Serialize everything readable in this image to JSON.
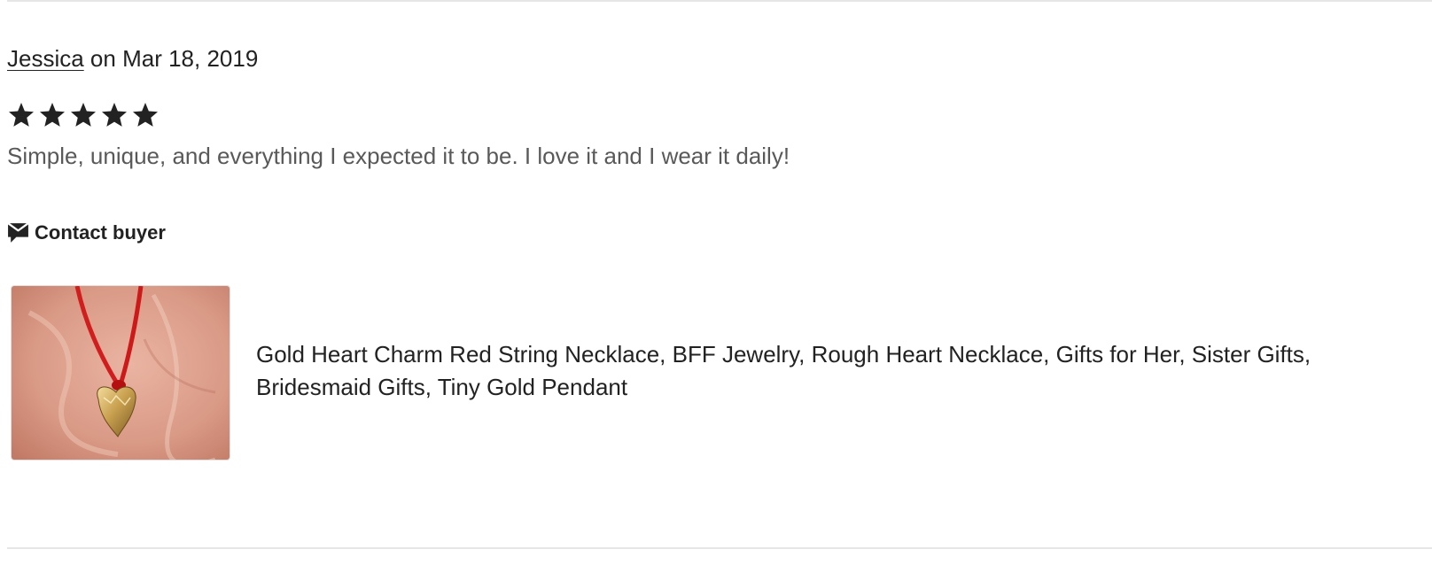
{
  "review": {
    "reviewer_name": "Jessica",
    "date_text": " on Mar 18, 2019",
    "rating": 5,
    "rating_max": 5,
    "star_icon": "star-icon",
    "text": "Simple, unique, and everything I expected it to be. I love it and I wear it daily!",
    "contact": {
      "icon": "message-icon",
      "label": "Contact buyer"
    },
    "listing": {
      "title": "Gold Heart Charm Red String Necklace, BFF Jewelry, Rough Heart Necklace, Gifts for Her, Sister Gifts, Bridesmaid Gifts, Tiny Gold Pendant",
      "image_alt": "Gold heart pendant on red string"
    }
  },
  "colors": {
    "text": "#222222",
    "muted_text": "#595959",
    "divider": "#e6e6e6"
  }
}
